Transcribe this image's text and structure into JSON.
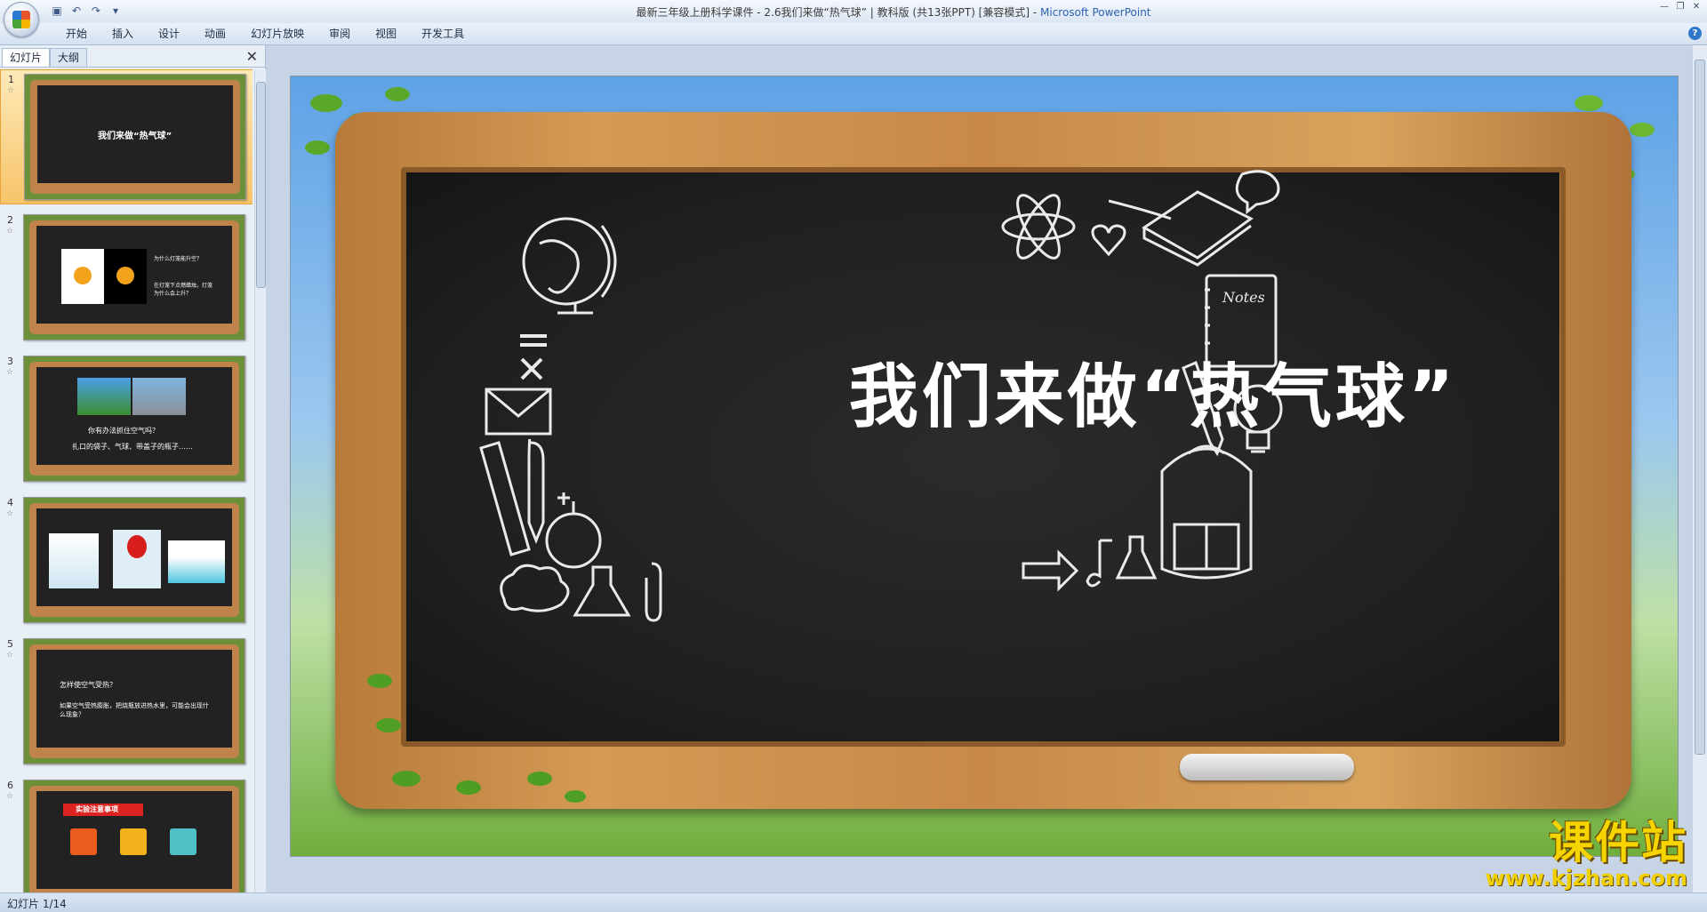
{
  "window": {
    "title": "最新三年级上册科学课件 - 2.6我们来做“热气球”  | 教科版  (共13张PPT) [兼容模式] - ",
    "app_name": "Microsoft PowerPoint"
  },
  "ribbon": {
    "tabs": [
      "开始",
      "插入",
      "设计",
      "动画",
      "幻灯片放映",
      "审阅",
      "视图",
      "开发工具"
    ]
  },
  "left_panel": {
    "tabs": [
      "幻灯片",
      "大纲"
    ],
    "close_glyph": "✕",
    "slides": [
      {
        "num": "1",
        "lines": [
          "我们来做“热气球”"
        ]
      },
      {
        "num": "2",
        "lines": [
          "为什么灯笼能升空？",
          "在灯笼下点燃蜡烛，灯笼为什么会上升？"
        ]
      },
      {
        "num": "3",
        "lines": [
          "你有办法抓住空气吗？",
          "扎口的袋子、气球、带盖子的瓶子……"
        ]
      },
      {
        "num": "4",
        "lines": []
      },
      {
        "num": "5",
        "lines": [
          "怎样使空气受热？",
          "如果空气受热膨胀，把烧瓶放进热水里，可能会出现什么现象？"
        ]
      },
      {
        "num": "6",
        "lines": [
          "实验注意事项"
        ]
      }
    ]
  },
  "slide": {
    "title": "我们来做“热气球”",
    "notes_doodle_text": "Notes"
  },
  "watermark": {
    "brand": "课件站",
    "url": "www.kjzhan.com"
  },
  "status": {
    "slide_counter": "幻灯片 1/14"
  },
  "colors": {
    "accent": "#2b63b0",
    "chalkboard": "#222222",
    "wood": "#c8894a",
    "selection": "#f7c46a"
  }
}
